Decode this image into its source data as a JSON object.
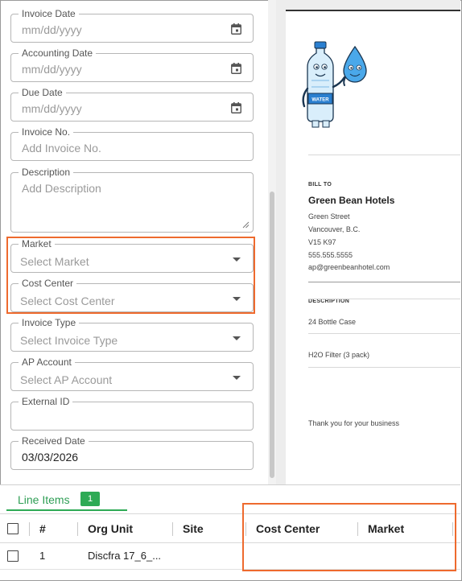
{
  "form": {
    "invoice_date": {
      "label": "Invoice Date",
      "placeholder": "mm/dd/yyyy"
    },
    "accounting_date": {
      "label": "Accounting Date",
      "placeholder": "mm/dd/yyyy"
    },
    "due_date": {
      "label": "Due Date",
      "placeholder": "mm/dd/yyyy"
    },
    "invoice_no": {
      "label": "Invoice No.",
      "placeholder": "Add Invoice No."
    },
    "description": {
      "label": "Description",
      "placeholder": "Add Description"
    },
    "market": {
      "label": "Market",
      "placeholder": "Select Market"
    },
    "cost_center": {
      "label": "Cost Center",
      "placeholder": "Select Cost Center"
    },
    "invoice_type": {
      "label": "Invoice Type",
      "placeholder": "Select Invoice Type"
    },
    "ap_account": {
      "label": "AP Account",
      "placeholder": "Select AP Account"
    },
    "external_id": {
      "label": "External ID",
      "value": ""
    },
    "received_date": {
      "label": "Received Date",
      "value": "03/03/2026"
    }
  },
  "preview": {
    "logo_text": "WATER",
    "bill_to_label": "BILL TO",
    "bill_to_name": "Green Bean Hotels",
    "address": [
      "Green Street",
      "Vancouver, B.C.",
      "V15 K97",
      "555.555.5555",
      "ap@greenbeanhotel.com"
    ],
    "description_header": "DESCRIPTION",
    "items": [
      "24 Bottle Case",
      "H2O Filter (3 pack)"
    ],
    "thanks": "Thank you for your business"
  },
  "line_items": {
    "tab_label": "Line Items",
    "count": "1",
    "columns": [
      "#",
      "Org Unit",
      "Site",
      "Cost Center",
      "Market"
    ],
    "rows": [
      {
        "number": "1",
        "org_unit": "Discfra 17_6_...",
        "site": "",
        "cost_center": "",
        "market": ""
      }
    ]
  },
  "colors": {
    "highlight": "#ee6a2e",
    "accent_green": "#2eaa55"
  },
  "icons": [
    "calendar-icon",
    "chevron-down-icon",
    "resize-grip-icon",
    "checkbox-icon"
  ]
}
